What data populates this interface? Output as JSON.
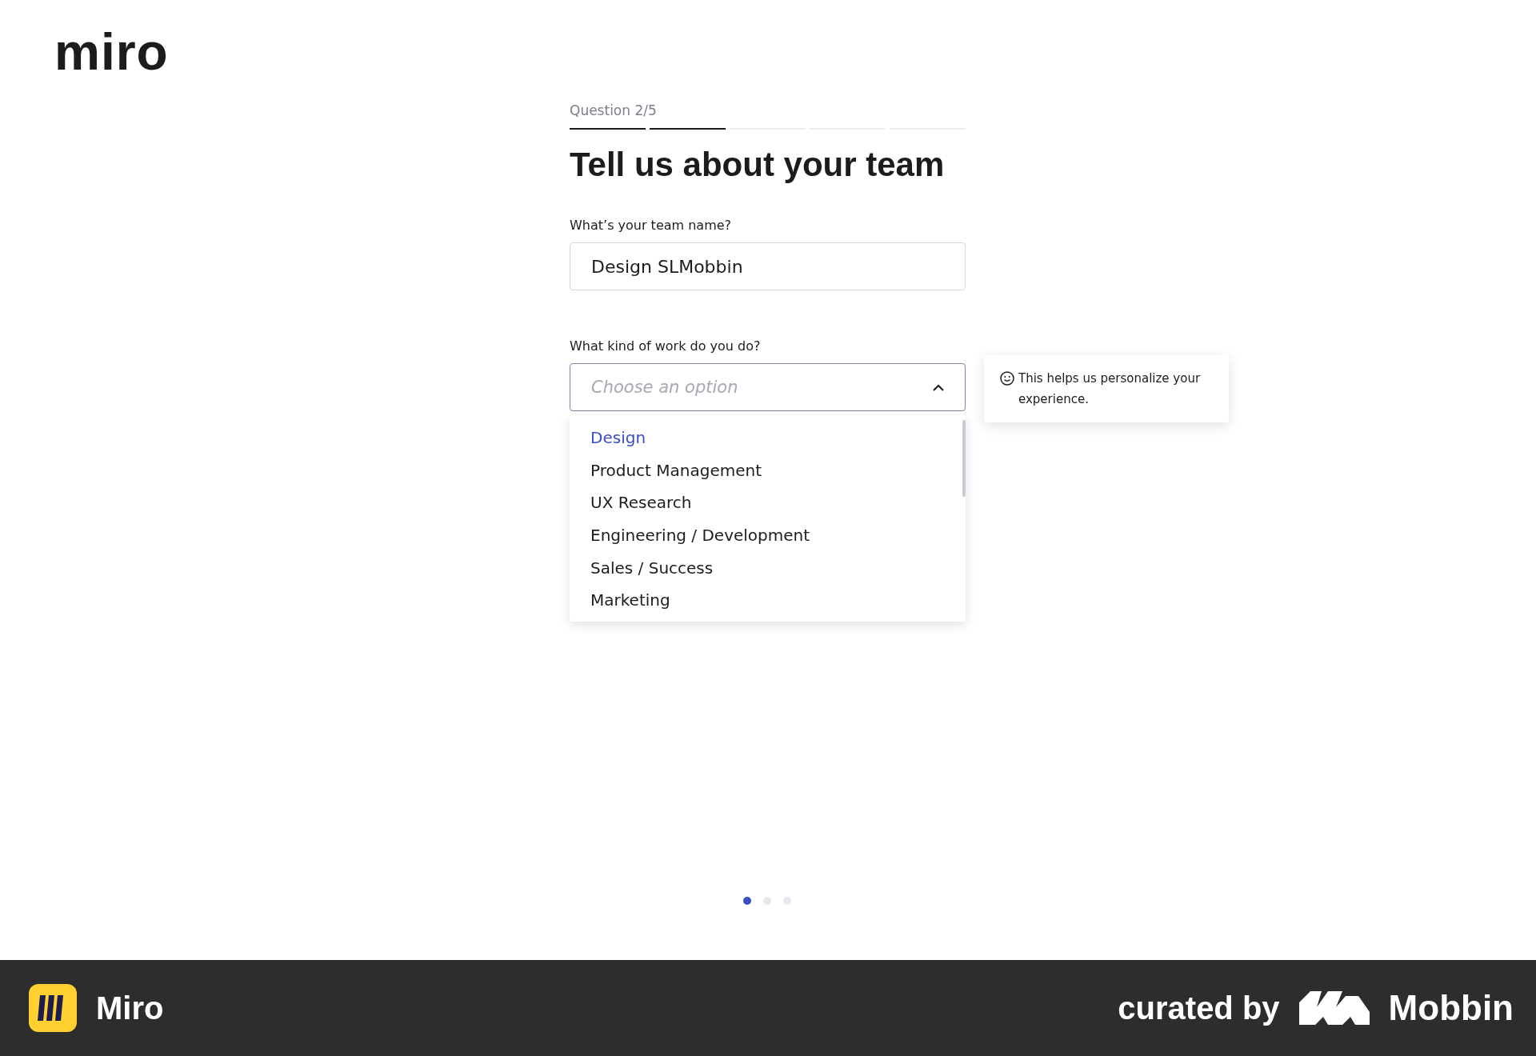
{
  "logo": "miro",
  "question": {
    "label": "Question 2/5",
    "progress": [
      {
        "done": true
      },
      {
        "done": true
      },
      {
        "done": false
      },
      {
        "done": false
      },
      {
        "done": false
      }
    ]
  },
  "heading": "Tell us about your team",
  "team_name": {
    "label": "What’s your team name?",
    "value": "Design SLMobbin"
  },
  "work_kind": {
    "label": "What kind of work do you do?",
    "placeholder": "Choose an option",
    "expanded": true,
    "options": [
      {
        "label": "Design",
        "selected": true
      },
      {
        "label": "Product Management",
        "selected": false
      },
      {
        "label": "UX Research",
        "selected": false
      },
      {
        "label": "Engineering / Development",
        "selected": false
      },
      {
        "label": "Sales / Success",
        "selected": false
      },
      {
        "label": "Marketing",
        "selected": false
      }
    ]
  },
  "tooltip": {
    "text": "This helps us personalize your experience."
  },
  "pager": [
    {
      "selected": true
    },
    {
      "selected": false
    },
    {
      "selected": false
    }
  ],
  "footer": {
    "app_name": "Miro",
    "curated_by": "curated by",
    "brand": "Mobbin"
  }
}
